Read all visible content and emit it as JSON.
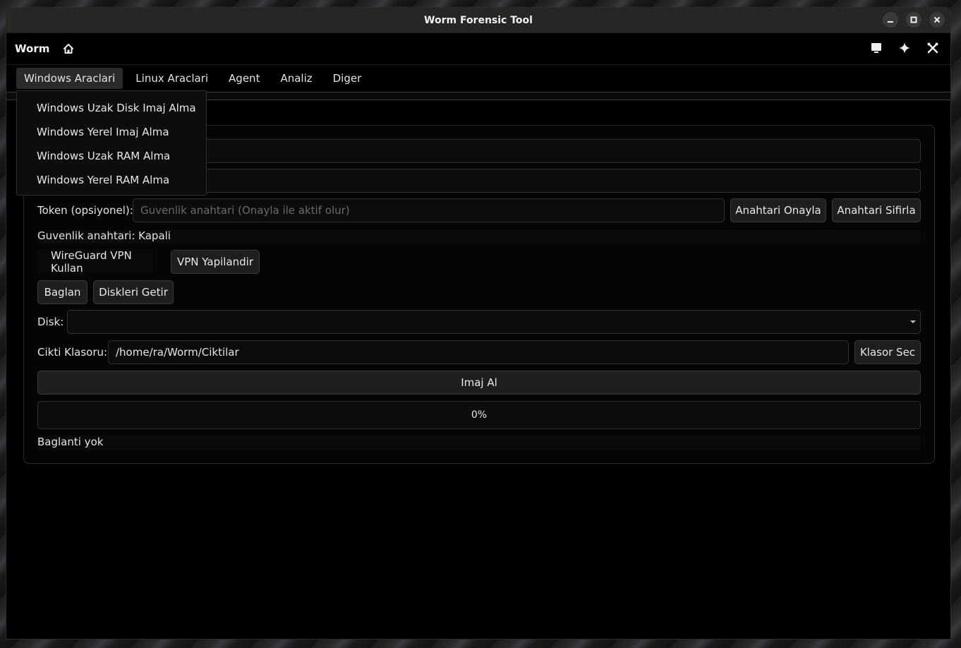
{
  "window": {
    "title": "Worm Forensic Tool",
    "controls": [
      "minimize-icon",
      "maximize-icon",
      "close-icon"
    ]
  },
  "appbar": {
    "name": "Worm",
    "icons": [
      "home-icon",
      "monitor-icon",
      "sparkle-icon",
      "tools-icon"
    ]
  },
  "menu": {
    "items": [
      {
        "label": "Windows Araclari"
      },
      {
        "label": "Linux Araclari"
      },
      {
        "label": "Agent"
      },
      {
        "label": "Analiz"
      },
      {
        "label": "Diger"
      }
    ],
    "active_index": 0
  },
  "dropdown": {
    "items": [
      {
        "label": "Windows Uzak Disk Imaj Alma"
      },
      {
        "label": "Windows Yerel Imaj Alma"
      },
      {
        "label": "Windows Uzak RAM Alma"
      },
      {
        "label": "Windows Yerel RAM Alma"
      }
    ]
  },
  "form": {
    "token_label": "Token (opsiyonel):",
    "token_placeholder": "Guvenlik anahtari (Onayla ile aktif olur)",
    "confirm_key_button": "Anahtari Onayla",
    "reset_key_button": "Anahtari Sifirla",
    "security_status": "Guvenlik anahtari: Kapali",
    "wireguard_label": "WireGuard VPN Kullan",
    "vpn_configure_button": "VPN Yapilandir",
    "connect_button": "Baglan",
    "fetch_disks_button": "Diskleri Getir",
    "disk_label": "Disk:",
    "disk_value": "",
    "output_label": "Cikti Klasoru:",
    "output_value": "/home/ra/Worm/Ciktilar",
    "choose_folder_button": "Klasor Sec",
    "take_image_button": "Imaj Al",
    "progress": {
      "value": 0,
      "label": "0%"
    },
    "connection_status": "Baglanti yok"
  },
  "colors": {
    "background": "#000000",
    "titlebar": "#262626",
    "button": "#1e1e1e",
    "accent": "#3a6fd8"
  }
}
